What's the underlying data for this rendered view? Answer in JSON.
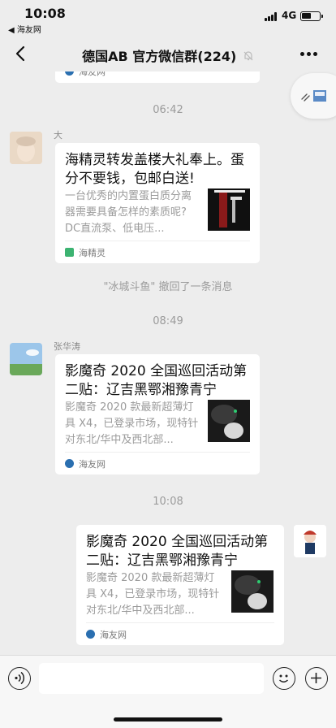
{
  "status_bar": {
    "time": "10:08",
    "back_app": "◀ 海友网",
    "network": "4G",
    "battery_level": 0.55
  },
  "nav": {
    "title": "德国AB 官方微信群(224)"
  },
  "messages": {
    "partial_card_source": "海友网",
    "time_1": "06:42",
    "msg1": {
      "sender": "大",
      "title": "海精灵转发盖楼大礼奉上。蛋分不要钱，包邮白送!",
      "desc": "一台优秀的内置蛋白质分离器需要具备怎样的素质呢? DC直流泵、低电压...",
      "source": "海精灵"
    },
    "recall_notice": "\"冰城斗鱼\" 撤回了一条消息",
    "time_2": "08:49",
    "msg2": {
      "sender": "张华涛",
      "title": "影魔奇 2020 全国巡回活动第二贴：辽吉黑鄂湘豫青宁",
      "desc": "影魔奇 2020 款最新超薄灯具 X4，已登录市场，现特针对东北/华中及西北部...",
      "source": "海友网"
    },
    "time_3": "10:08",
    "msg3": {
      "title": "影魔奇 2020 全国巡回活动第二贴：辽吉黑鄂湘豫青宁",
      "desc": "影魔奇 2020 款最新超薄灯具 X4，已登录市场，现特针对东北/华中及西北部...",
      "source": "海友网"
    }
  },
  "input": {
    "placeholder": ""
  },
  "colors": {
    "background": "#ededed",
    "card": "#ffffff",
    "meta_text": "#9b9b9b",
    "source_green": "#3cb371",
    "source_blue": "#2a6fb0"
  }
}
